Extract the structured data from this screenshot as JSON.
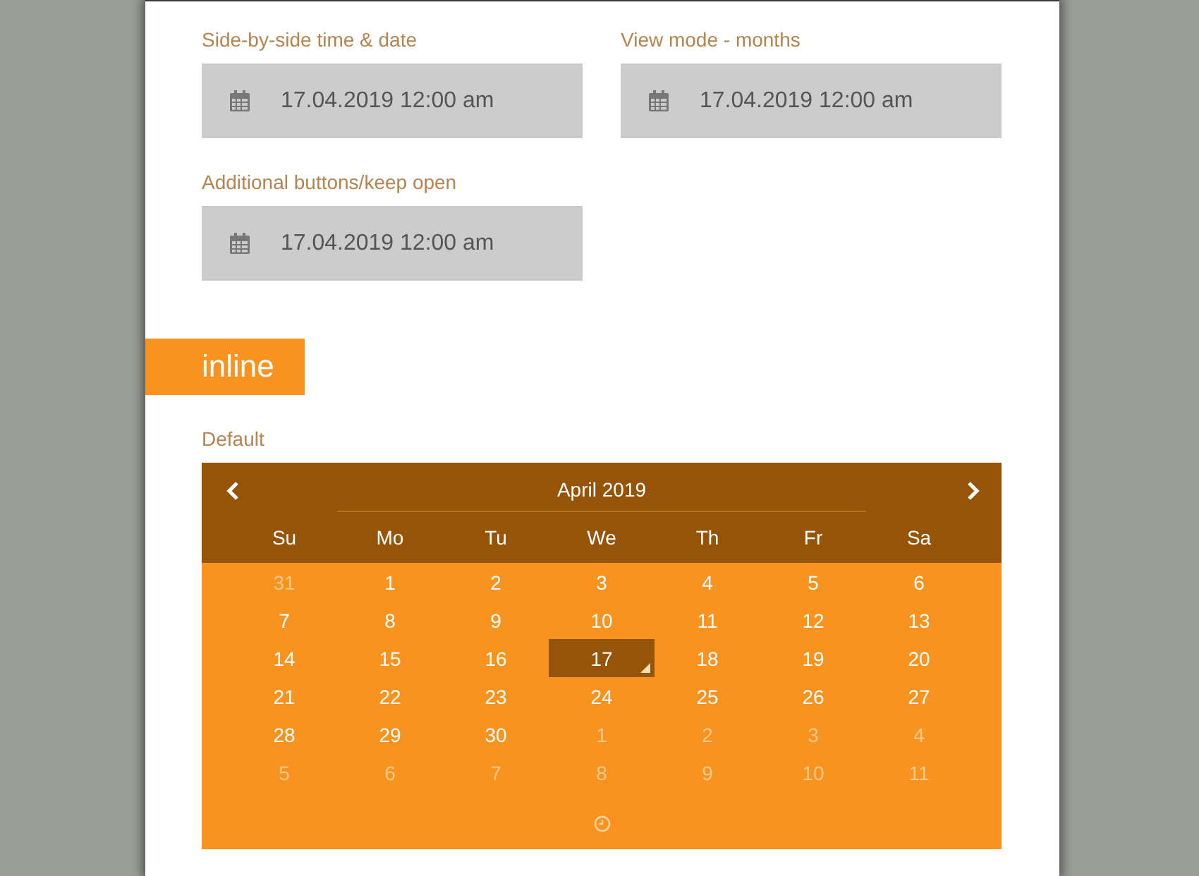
{
  "fields": [
    {
      "label": "Side-by-side time & date",
      "value": "17.04.2019 12:00 am"
    },
    {
      "label": "View mode - months",
      "value": "17.04.2019 12:00 am"
    },
    {
      "label": "Additional buttons/keep open",
      "value": "17.04.2019 12:00 am"
    }
  ],
  "section": {
    "title": "inline"
  },
  "calendar": {
    "label": "Default",
    "title": "April 2019",
    "weekdays": [
      "Su",
      "Mo",
      "Tu",
      "We",
      "Th",
      "Fr",
      "Sa"
    ],
    "weeks": [
      [
        {
          "day": "31",
          "other_month": true,
          "selected": false,
          "today": false
        },
        {
          "day": "1",
          "other_month": false,
          "selected": false,
          "today": false
        },
        {
          "day": "2",
          "other_month": false,
          "selected": false,
          "today": false
        },
        {
          "day": "3",
          "other_month": false,
          "selected": false,
          "today": false
        },
        {
          "day": "4",
          "other_month": false,
          "selected": false,
          "today": false
        },
        {
          "day": "5",
          "other_month": false,
          "selected": false,
          "today": false
        },
        {
          "day": "6",
          "other_month": false,
          "selected": false,
          "today": false
        }
      ],
      [
        {
          "day": "7",
          "other_month": false,
          "selected": false,
          "today": false
        },
        {
          "day": "8",
          "other_month": false,
          "selected": false,
          "today": false
        },
        {
          "day": "9",
          "other_month": false,
          "selected": false,
          "today": false
        },
        {
          "day": "10",
          "other_month": false,
          "selected": false,
          "today": false
        },
        {
          "day": "11",
          "other_month": false,
          "selected": false,
          "today": false
        },
        {
          "day": "12",
          "other_month": false,
          "selected": false,
          "today": false
        },
        {
          "day": "13",
          "other_month": false,
          "selected": false,
          "today": false
        }
      ],
      [
        {
          "day": "14",
          "other_month": false,
          "selected": false,
          "today": false
        },
        {
          "day": "15",
          "other_month": false,
          "selected": false,
          "today": false
        },
        {
          "day": "16",
          "other_month": false,
          "selected": false,
          "today": false
        },
        {
          "day": "17",
          "other_month": false,
          "selected": true,
          "today": true
        },
        {
          "day": "18",
          "other_month": false,
          "selected": false,
          "today": false
        },
        {
          "day": "19",
          "other_month": false,
          "selected": false,
          "today": false
        },
        {
          "day": "20",
          "other_month": false,
          "selected": false,
          "today": false
        }
      ],
      [
        {
          "day": "21",
          "other_month": false,
          "selected": false,
          "today": false
        },
        {
          "day": "22",
          "other_month": false,
          "selected": false,
          "today": false
        },
        {
          "day": "23",
          "other_month": false,
          "selected": false,
          "today": false
        },
        {
          "day": "24",
          "other_month": false,
          "selected": false,
          "today": false
        },
        {
          "day": "25",
          "other_month": false,
          "selected": false,
          "today": false
        },
        {
          "day": "26",
          "other_month": false,
          "selected": false,
          "today": false
        },
        {
          "day": "27",
          "other_month": false,
          "selected": false,
          "today": false
        }
      ],
      [
        {
          "day": "28",
          "other_month": false,
          "selected": false,
          "today": false
        },
        {
          "day": "29",
          "other_month": false,
          "selected": false,
          "today": false
        },
        {
          "day": "30",
          "other_month": false,
          "selected": false,
          "today": false
        },
        {
          "day": "1",
          "other_month": true,
          "selected": false,
          "today": false
        },
        {
          "day": "2",
          "other_month": true,
          "selected": false,
          "today": false
        },
        {
          "day": "3",
          "other_month": true,
          "selected": false,
          "today": false
        },
        {
          "day": "4",
          "other_month": true,
          "selected": false,
          "today": false
        }
      ],
      [
        {
          "day": "5",
          "other_month": true,
          "selected": false,
          "today": false
        },
        {
          "day": "6",
          "other_month": true,
          "selected": false,
          "today": false
        },
        {
          "day": "7",
          "other_month": true,
          "selected": false,
          "today": false
        },
        {
          "day": "8",
          "other_month": true,
          "selected": false,
          "today": false
        },
        {
          "day": "9",
          "other_month": true,
          "selected": false,
          "today": false
        },
        {
          "day": "10",
          "other_month": true,
          "selected": false,
          "today": false
        },
        {
          "day": "11",
          "other_month": true,
          "selected": false,
          "today": false
        }
      ]
    ]
  }
}
